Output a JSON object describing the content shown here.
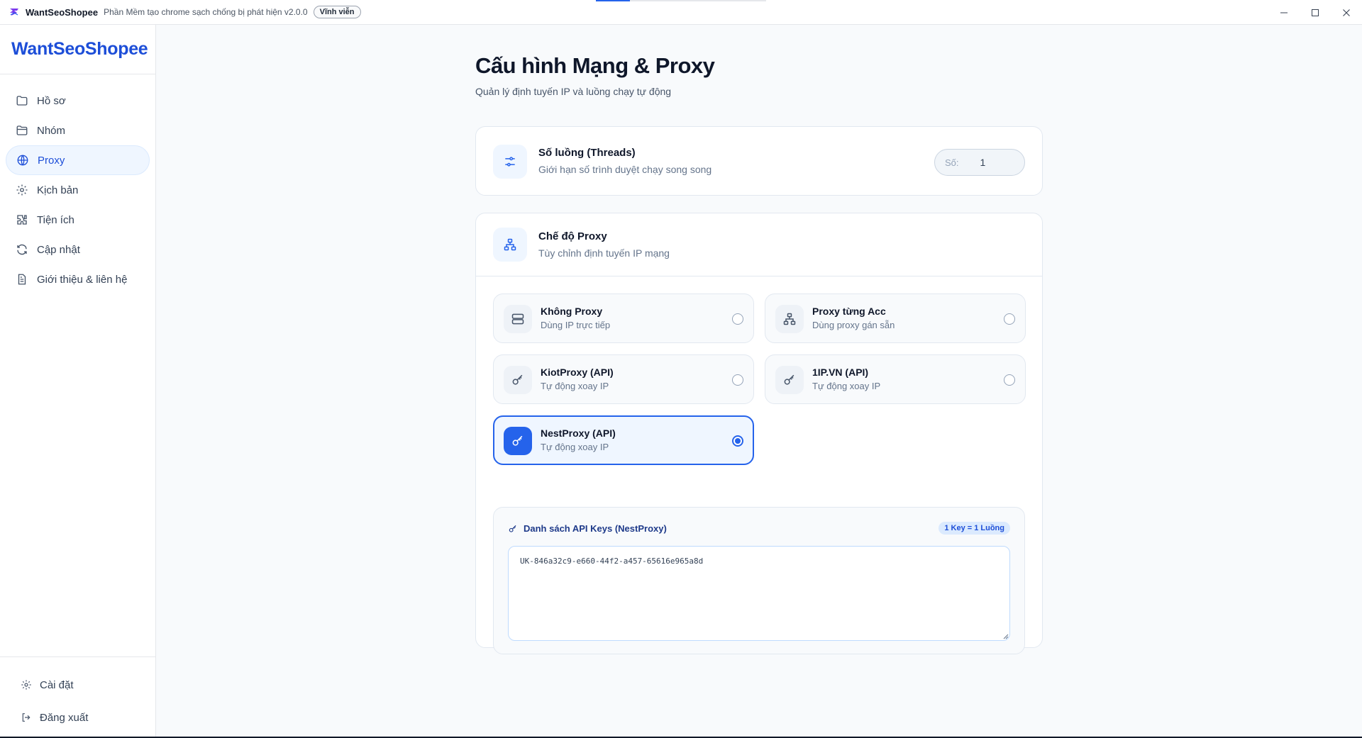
{
  "titlebar": {
    "app_name": "WantSeoShopee",
    "subtitle": "Phần Mềm tạo chrome sạch chống bị phát hiện v2.0.0",
    "license_badge": "Vĩnh viễn",
    "progress": 0.2
  },
  "sidebar": {
    "brand": "WantSeoShopee",
    "items": [
      {
        "label": "Hồ sơ",
        "icon": "folder-icon"
      },
      {
        "label": "Nhóm",
        "icon": "folder-open-icon"
      },
      {
        "label": "Proxy",
        "icon": "globe-icon",
        "active": true
      },
      {
        "label": "Kịch bản",
        "icon": "gear-icon"
      },
      {
        "label": "Tiện ích",
        "icon": "puzzle-icon"
      },
      {
        "label": "Cập nhật",
        "icon": "refresh-icon"
      },
      {
        "label": "Giới thiệu & liên hệ",
        "icon": "document-icon"
      }
    ],
    "bottom": [
      {
        "label": "Cài đặt",
        "icon": "gear-icon"
      },
      {
        "label": "Đăng xuất",
        "icon": "logout-icon"
      }
    ]
  },
  "main": {
    "title": "Cấu hình Mạng & Proxy",
    "subtitle": "Quản lý định tuyến IP và luồng chạy tự động",
    "threads": {
      "title": "Số luồng (Threads)",
      "description": "Giới hạn số trình duyệt chạy song song",
      "input_label": "Số:",
      "input_value": "1"
    },
    "proxy_mode": {
      "title": "Chế độ Proxy",
      "description": "Tùy chỉnh định tuyến IP mạng",
      "options": [
        {
          "title": "Không Proxy",
          "sub": "Dùng IP trực tiếp",
          "icon": "server-icon",
          "selected": false
        },
        {
          "title": "Proxy từng Acc",
          "sub": "Dùng proxy gán sẵn",
          "icon": "network-icon",
          "selected": false
        },
        {
          "title": "KiotProxy (API)",
          "sub": "Tự động xoay IP",
          "icon": "key-icon",
          "selected": false
        },
        {
          "title": "1IP.VN (API)",
          "sub": "Tự động xoay IP",
          "icon": "key-icon",
          "selected": false
        },
        {
          "title": "NestProxy (API)",
          "sub": "Tự động xoay IP",
          "icon": "key-icon",
          "selected": true
        }
      ],
      "api_keys": {
        "title": "Danh sách API Keys (NestProxy)",
        "badge": "1 Key = 1 Luồng",
        "value": "UK-846a32c9-e660-44f2-a457-65616e965a8d"
      }
    }
  },
  "colors": {
    "accent": "#2563eb",
    "brand": "#1d4ed8"
  }
}
